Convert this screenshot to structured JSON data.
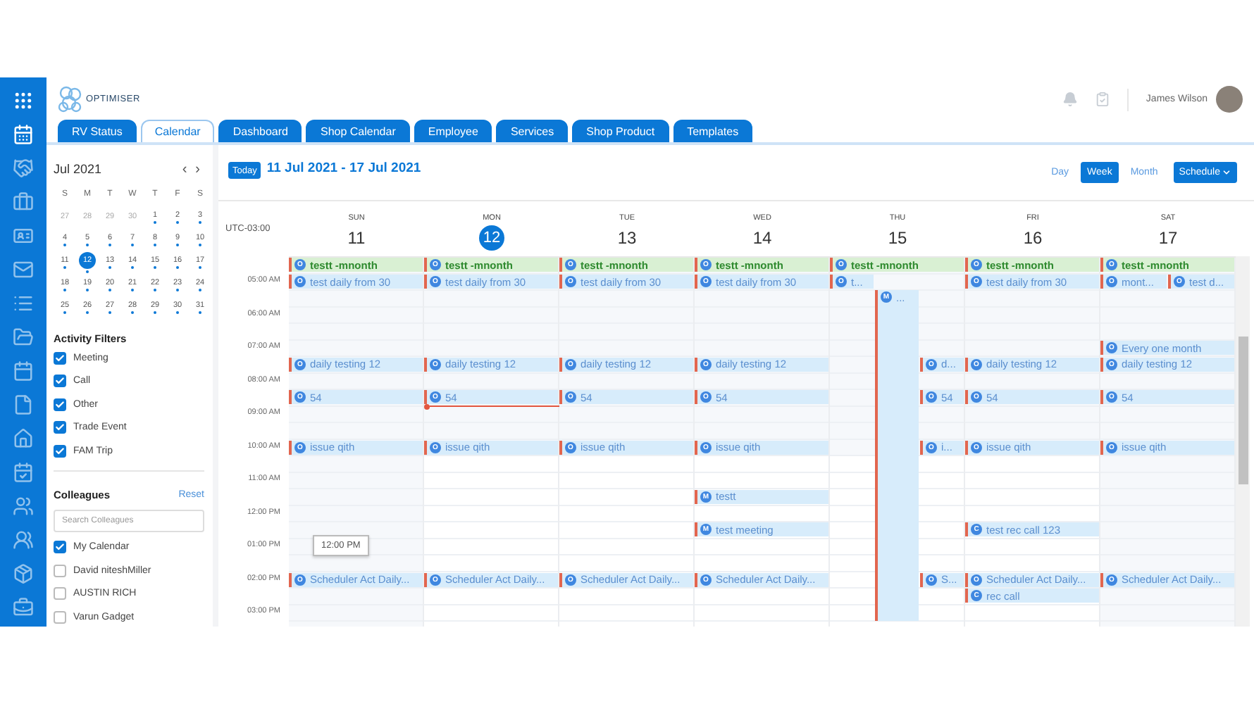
{
  "rail": {
    "items": [
      {
        "selected": true
      },
      {
        "selected": false
      },
      {
        "selected": false
      },
      {
        "selected": false
      },
      {
        "selected": false
      },
      {
        "selected": false
      },
      {
        "selected": false
      },
      {
        "selected": false
      },
      {
        "selected": false
      },
      {
        "selected": false
      },
      {
        "selected": false
      },
      {
        "selected": false
      },
      {
        "selected": false
      },
      {
        "selected": false
      },
      {
        "selected": false
      }
    ]
  },
  "header": {
    "brand": "OPTIMISER",
    "user_name": "James Wilson"
  },
  "tabs": [
    {
      "label": "RV Status",
      "selected": false
    },
    {
      "label": "Calendar",
      "selected": true
    },
    {
      "label": "Dashboard",
      "selected": false
    },
    {
      "label": "Shop Calendar",
      "selected": false
    },
    {
      "label": "Employee",
      "selected": false
    },
    {
      "label": "Services",
      "selected": false
    },
    {
      "label": "Shop Product",
      "selected": false
    },
    {
      "label": "Templates",
      "selected": false
    }
  ],
  "mini_calendar": {
    "month": "Jul 2021",
    "prev": "‹",
    "next": "›",
    "weekdays": [
      "S",
      "M",
      "T",
      "W",
      "T",
      "F",
      "S"
    ],
    "weeks": [
      [
        {
          "day": "27",
          "outside": true,
          "selected": false
        },
        {
          "day": "28",
          "outside": true,
          "selected": false
        },
        {
          "day": "29",
          "outside": true,
          "selected": false
        },
        {
          "day": "30",
          "outside": true,
          "selected": false
        },
        {
          "day": "1",
          "outside": false,
          "selected": false
        },
        {
          "day": "2",
          "outside": false,
          "selected": false
        },
        {
          "day": "3",
          "outside": false,
          "selected": false
        }
      ],
      [
        {
          "day": "4",
          "outside": false,
          "selected": false
        },
        {
          "day": "5",
          "outside": false,
          "selected": false
        },
        {
          "day": "6",
          "outside": false,
          "selected": false
        },
        {
          "day": "7",
          "outside": false,
          "selected": false
        },
        {
          "day": "8",
          "outside": false,
          "selected": false
        },
        {
          "day": "9",
          "outside": false,
          "selected": false
        },
        {
          "day": "10",
          "outside": false,
          "selected": false
        }
      ],
      [
        {
          "day": "11",
          "outside": false,
          "selected": false
        },
        {
          "day": "12",
          "outside": false,
          "selected": true
        },
        {
          "day": "13",
          "outside": false,
          "selected": false
        },
        {
          "day": "14",
          "outside": false,
          "selected": false
        },
        {
          "day": "15",
          "outside": false,
          "selected": false
        },
        {
          "day": "16",
          "outside": false,
          "selected": false
        },
        {
          "day": "17",
          "outside": false,
          "selected": false
        }
      ],
      [
        {
          "day": "18",
          "outside": false,
          "selected": false
        },
        {
          "day": "19",
          "outside": false,
          "selected": false
        },
        {
          "day": "20",
          "outside": false,
          "selected": false
        },
        {
          "day": "21",
          "outside": false,
          "selected": false
        },
        {
          "day": "22",
          "outside": false,
          "selected": false
        },
        {
          "day": "23",
          "outside": false,
          "selected": false
        },
        {
          "day": "24",
          "outside": false,
          "selected": false
        }
      ],
      [
        {
          "day": "25",
          "outside": false,
          "selected": false
        },
        {
          "day": "26",
          "outside": false,
          "selected": false
        },
        {
          "day": "27",
          "outside": false,
          "selected": false
        },
        {
          "day": "28",
          "outside": false,
          "selected": false
        },
        {
          "day": "29",
          "outside": false,
          "selected": false
        },
        {
          "day": "30",
          "outside": false,
          "selected": false
        },
        {
          "day": "31",
          "outside": false,
          "selected": false
        }
      ]
    ]
  },
  "activity_filters": {
    "title": "Activity Filters",
    "items": [
      {
        "label": "Meeting",
        "checked": true
      },
      {
        "label": "Call",
        "checked": true
      },
      {
        "label": "Other",
        "checked": true
      },
      {
        "label": "Trade Event",
        "checked": true
      },
      {
        "label": "FAM Trip",
        "checked": true
      }
    ]
  },
  "colleagues": {
    "title": "Colleagues",
    "reset": "Reset",
    "search": {
      "placeholder": "Search Colleagues"
    },
    "items": [
      {
        "name": "My Calendar",
        "checked": true
      },
      {
        "name": "David niteshMiller",
        "checked": false
      },
      {
        "name": "AUSTIN RICH",
        "checked": false
      },
      {
        "name": "Varun Gadget",
        "checked": false
      }
    ]
  },
  "toolbar": {
    "today": "Today",
    "range": "11 Jul 2021 - 17 Jul 2021",
    "views": [
      {
        "label": "Day",
        "selected": false
      },
      {
        "label": "Week",
        "selected": true
      },
      {
        "label": "Month",
        "selected": false
      }
    ],
    "schedule": "Schedule"
  },
  "timezone": "UTC-03:00",
  "days": [
    {
      "weekday": "SUN",
      "date": "11",
      "selected": false,
      "weekend": true
    },
    {
      "weekday": "MON",
      "date": "12",
      "selected": true,
      "weekend": false
    },
    {
      "weekday": "TUE",
      "date": "13",
      "selected": false,
      "weekend": false
    },
    {
      "weekday": "WED",
      "date": "14",
      "selected": false,
      "weekend": false
    },
    {
      "weekday": "THU",
      "date": "15",
      "selected": false,
      "weekend": false
    },
    {
      "weekday": "FRI",
      "date": "16",
      "selected": false,
      "weekend": false
    },
    {
      "weekday": "SAT",
      "date": "17",
      "selected": false,
      "weekend": true
    }
  ],
  "rows": [
    {
      "sun": [
        {
          "title": "testt -mnonth",
          "badge": "O",
          "kind": "banner"
        }
      ],
      "mon": [
        {
          "title": "testt -mnonth",
          "badge": "O",
          "kind": "banner"
        }
      ],
      "tue": [
        {
          "title": "testt -mnonth",
          "badge": "O",
          "kind": "banner"
        }
      ],
      "wed": [
        {
          "title": "testt -mnonth",
          "badge": "O",
          "kind": "banner"
        }
      ],
      "thu": [
        {
          "title": "testt -mnonth",
          "badge": "O",
          "kind": "banner"
        }
      ],
      "fri": [
        {
          "title": "testt -mnonth",
          "badge": "O",
          "kind": "banner"
        }
      ],
      "sat": [
        {
          "title": "testt -mnonth",
          "badge": "O",
          "kind": "banner"
        }
      ]
    },
    {
      "label": "05:00 AM",
      "sun": [
        {
          "title": "test daily from 30",
          "badge": "O",
          "kind": "full"
        }
      ],
      "mon": [
        {
          "title": "test daily from 30",
          "badge": "O",
          "kind": "full"
        }
      ],
      "tue": [
        {
          "title": "test daily from 30",
          "badge": "O",
          "kind": "full"
        }
      ],
      "wed": [
        {
          "title": "test daily from 30",
          "badge": "O",
          "kind": "full"
        }
      ],
      "thu": [
        {
          "title": "t...",
          "badge": "O",
          "kind": "third1"
        }
      ],
      "fri": [
        {
          "title": "test daily from 30",
          "badge": "O",
          "kind": "full"
        }
      ],
      "sat": [
        {
          "title": "mont...",
          "badge": "O",
          "kind": "half1"
        },
        {
          "title": "test d...",
          "badge": "O",
          "kind": "half2"
        }
      ]
    },
    {
      "thu": [
        {
          "title": "...",
          "badge": "M",
          "kind": "third2"
        }
      ]
    },
    {
      "label": "06:00 AM",
      "thu": [
        {
          "kind": "continuation"
        }
      ]
    },
    {
      "thu": [
        {
          "kind": "continuation"
        }
      ]
    },
    {
      "label": "07:00 AM",
      "thu": [
        {
          "kind": "continuation"
        }
      ],
      "sat": [
        {
          "title": "Every one month",
          "badge": "O",
          "kind": "full"
        }
      ]
    },
    {
      "sun": [
        {
          "title": "daily testing 12",
          "badge": "O",
          "kind": "full"
        }
      ],
      "mon": [
        {
          "title": "daily testing 12",
          "badge": "O",
          "kind": "full"
        }
      ],
      "tue": [
        {
          "title": "daily testing 12",
          "badge": "O",
          "kind": "full"
        }
      ],
      "wed": [
        {
          "title": "daily testing 12",
          "badge": "O",
          "kind": "full"
        }
      ],
      "thu": [
        {
          "kind": "continuation"
        },
        {
          "title": "d...",
          "badge": "O",
          "kind": "third3"
        }
      ],
      "fri": [
        {
          "title": "daily testing 12",
          "badge": "O",
          "kind": "full"
        }
      ],
      "sat": [
        {
          "title": "daily testing 12",
          "badge": "O",
          "kind": "full"
        }
      ]
    },
    {
      "label": "08:00 AM",
      "thu": [
        {
          "kind": "continuation"
        }
      ]
    },
    {
      "sun": [
        {
          "title": "54",
          "badge": "O",
          "kind": "full"
        }
      ],
      "mon": [
        {
          "title": "54",
          "badge": "O",
          "kind": "full"
        }
      ],
      "tue": [
        {
          "title": "54",
          "badge": "O",
          "kind": "full"
        }
      ],
      "wed": [
        {
          "title": "54",
          "badge": "O",
          "kind": "full"
        }
      ],
      "thu": [
        {
          "kind": "continuation"
        },
        {
          "title": "54",
          "badge": "O",
          "kind": "third3"
        }
      ],
      "fri": [
        {
          "title": "54",
          "badge": "O",
          "kind": "full"
        }
      ],
      "sat": [
        {
          "title": "54",
          "badge": "O",
          "kind": "full"
        }
      ]
    },
    {
      "label": "09:00 AM",
      "now": true,
      "thu": [
        {
          "kind": "continuation"
        }
      ]
    },
    {
      "thu": [
        {
          "kind": "continuation"
        }
      ]
    },
    {
      "label": "10:00 AM",
      "sun": [
        {
          "title": "issue qith",
          "badge": "O",
          "kind": "full"
        }
      ],
      "mon": [
        {
          "title": "issue qith",
          "badge": "O",
          "kind": "full"
        }
      ],
      "tue": [
        {
          "title": "issue qith",
          "badge": "O",
          "kind": "full"
        }
      ],
      "wed": [
        {
          "title": "issue qith",
          "badge": "O",
          "kind": "full"
        }
      ],
      "thu": [
        {
          "kind": "continuation"
        },
        {
          "title": "i...",
          "badge": "O",
          "kind": "third3"
        }
      ],
      "fri": [
        {
          "title": "issue qith",
          "badge": "O",
          "kind": "full"
        }
      ],
      "sat": [
        {
          "title": "issue qith",
          "badge": "O",
          "kind": "full"
        }
      ]
    },
    {
      "thu": [
        {
          "kind": "continuation"
        }
      ]
    },
    {
      "label": "11:00 AM",
      "thu": [
        {
          "kind": "continuation"
        }
      ]
    },
    {
      "wed": [
        {
          "title": "testt",
          "badge": "M",
          "kind": "full"
        }
      ],
      "thu": [
        {
          "kind": "continuation"
        }
      ]
    },
    {
      "label": "12:00 PM",
      "thu": [
        {
          "kind": "continuation"
        }
      ]
    },
    {
      "wed": [
        {
          "title": "test meeting",
          "badge": "M",
          "kind": "full"
        }
      ],
      "thu": [
        {
          "kind": "continuation"
        }
      ],
      "fri": [
        {
          "title": "test rec call 123",
          "badge": "C",
          "kind": "full"
        }
      ]
    },
    {
      "label": "01:00 PM",
      "tooltip": {
        "text": "12:00 PM"
      },
      "thu": [
        {
          "kind": "continuation"
        }
      ]
    },
    {
      "thu": [
        {
          "kind": "continuation"
        }
      ]
    },
    {
      "label": "02:00 PM",
      "sun": [
        {
          "title": "Scheduler Act Daily...",
          "badge": "O",
          "kind": "full"
        }
      ],
      "mon": [
        {
          "title": "Scheduler Act Daily...",
          "badge": "O",
          "kind": "full"
        }
      ],
      "tue": [
        {
          "title": "Scheduler Act Daily...",
          "badge": "O",
          "kind": "full"
        }
      ],
      "wed": [
        {
          "title": "Scheduler Act Daily...",
          "badge": "O",
          "kind": "full"
        }
      ],
      "thu": [
        {
          "kind": "continuation"
        },
        {
          "title": "S...",
          "badge": "O",
          "kind": "third3"
        }
      ],
      "fri": [
        {
          "title": "Scheduler Act Daily...",
          "badge": "O",
          "kind": "full"
        }
      ],
      "sat": [
        {
          "title": "Scheduler Act Daily...",
          "badge": "O",
          "kind": "full"
        }
      ]
    },
    {
      "thu": [
        {
          "kind": "continuation"
        }
      ],
      "fri": [
        {
          "title": "rec call",
          "badge": "C",
          "kind": "full"
        }
      ]
    },
    {
      "label": "03:00 PM",
      "thu": [
        {
          "kind": "continuation"
        }
      ]
    }
  ]
}
